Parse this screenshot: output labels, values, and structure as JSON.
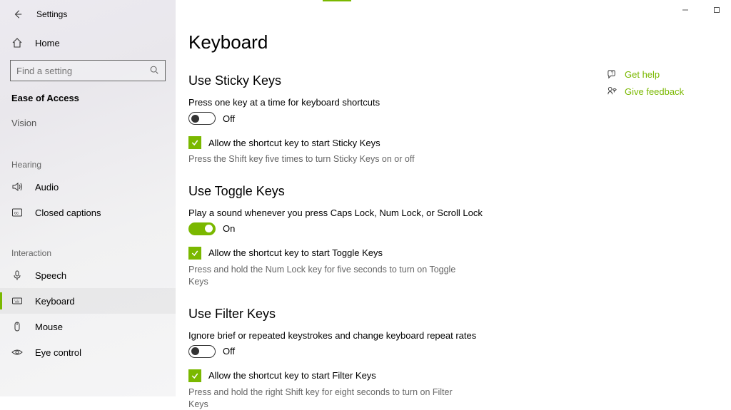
{
  "app_title": "Settings",
  "search_placeholder": "Find a setting",
  "sidebar": {
    "home": "Home",
    "category": "Ease of Access",
    "group1": "Vision",
    "group2": "Hearing",
    "audio": "Audio",
    "cc": "Closed captions",
    "group3": "Interaction",
    "speech": "Speech",
    "keyboard": "Keyboard",
    "mouse": "Mouse",
    "eye": "Eye control"
  },
  "page_title": "Keyboard",
  "sticky": {
    "title": "Use Sticky Keys",
    "desc": "Press one key at a time for keyboard shortcuts",
    "state": "Off",
    "check": "Allow the shortcut key to start Sticky Keys",
    "hint": "Press the Shift key five times to turn Sticky Keys on or off"
  },
  "toggle": {
    "title": "Use Toggle Keys",
    "desc": "Play a sound whenever you press Caps Lock, Num Lock, or Scroll Lock",
    "state": "On",
    "check": "Allow the shortcut key to start Toggle Keys",
    "hint": "Press and hold the Num Lock key for five seconds to turn on Toggle Keys"
  },
  "filter": {
    "title": "Use Filter Keys",
    "desc": "Ignore brief or repeated keystrokes and change keyboard repeat rates",
    "state": "Off",
    "check": "Allow the shortcut key to start Filter Keys",
    "hint": "Press and hold the right Shift key for eight seconds to turn on Filter Keys"
  },
  "help": {
    "get_help": "Get help",
    "feedback": "Give feedback"
  }
}
